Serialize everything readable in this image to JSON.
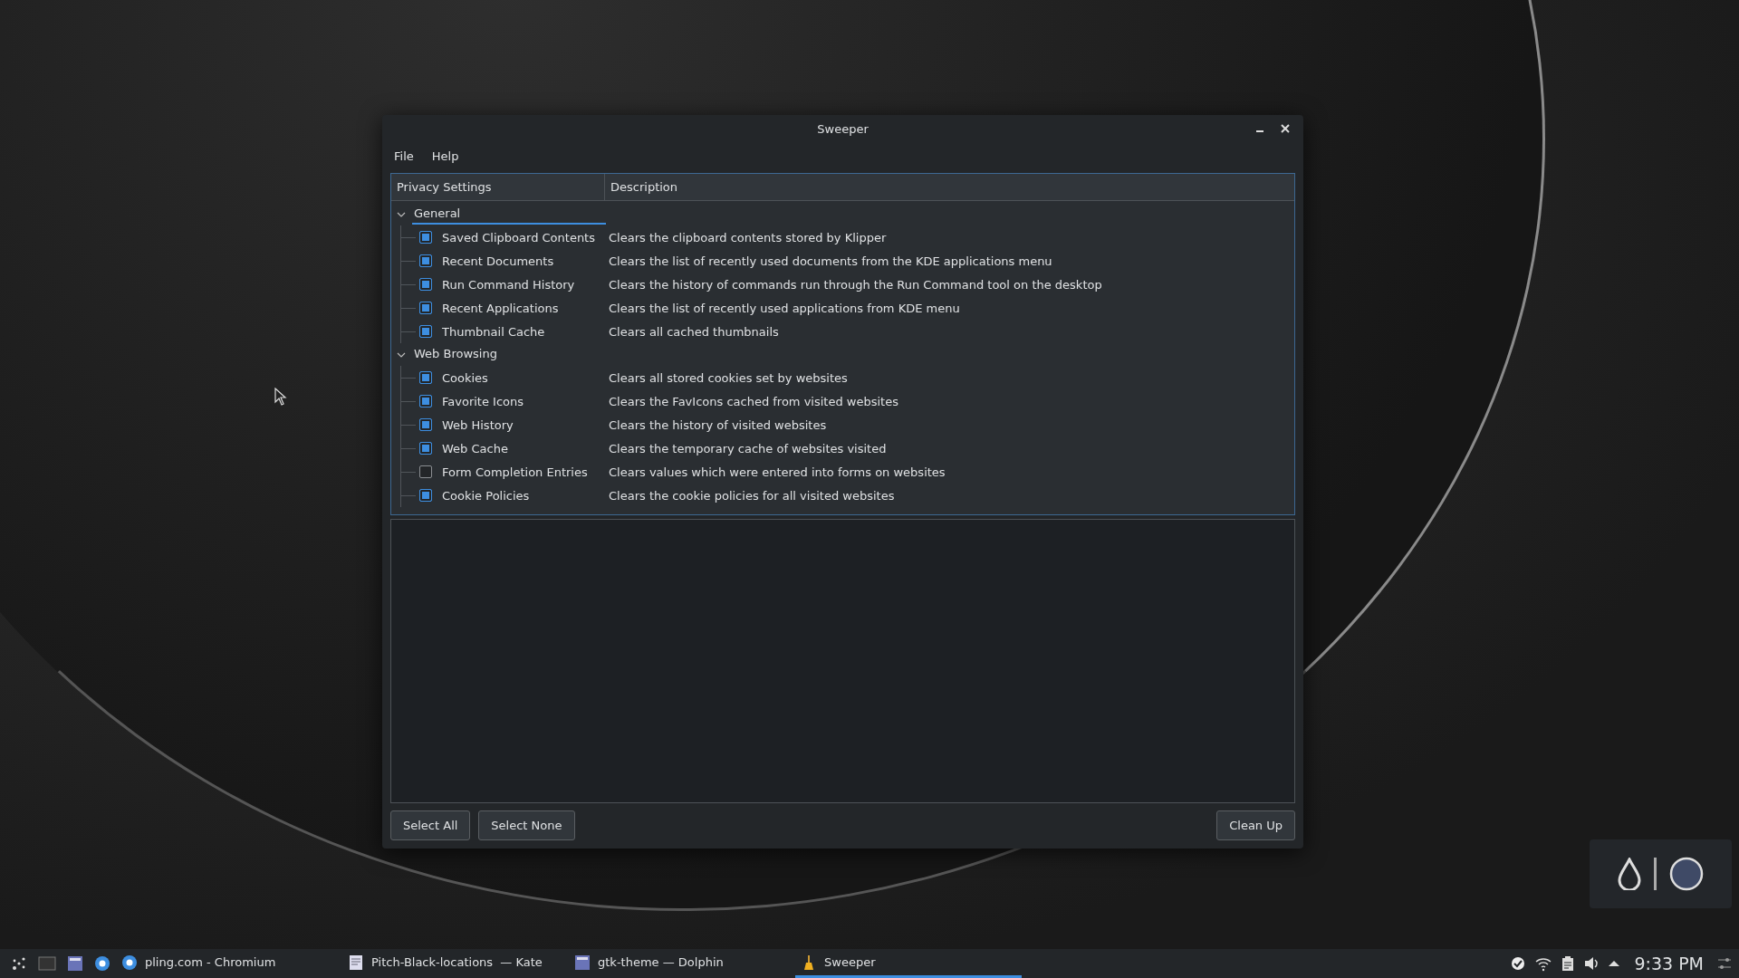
{
  "window": {
    "title": "Sweeper"
  },
  "menu": [
    "File",
    "Help"
  ],
  "tree": {
    "columns": [
      "Privacy Settings",
      "Description"
    ],
    "groups": [
      {
        "label": "General",
        "expanded": true,
        "selected": true,
        "children": [
          {
            "label": "Saved Clipboard Contents",
            "description": "Clears the clipboard contents stored by Klipper",
            "checked": true
          },
          {
            "label": "Recent Documents",
            "description": "Clears the list of recently used documents from the KDE applications menu",
            "checked": true
          },
          {
            "label": "Run Command History",
            "description": "Clears the history of commands run through the Run Command tool on the desktop",
            "checked": true
          },
          {
            "label": "Recent Applications",
            "description": "Clears the list of recently used applications from KDE menu",
            "checked": true
          },
          {
            "label": "Thumbnail Cache",
            "description": "Clears all cached thumbnails",
            "checked": true
          }
        ]
      },
      {
        "label": "Web Browsing",
        "expanded": true,
        "selected": false,
        "children": [
          {
            "label": "Cookies",
            "description": "Clears all stored cookies set by websites",
            "checked": true
          },
          {
            "label": "Favorite Icons",
            "description": "Clears the FavIcons cached from visited websites",
            "checked": true
          },
          {
            "label": "Web History",
            "description": "Clears the history of visited websites",
            "checked": true
          },
          {
            "label": "Web Cache",
            "description": "Clears the temporary cache of websites visited",
            "checked": true
          },
          {
            "label": "Form Completion Entries",
            "description": "Clears values which were entered into forms on websites",
            "checked": false
          },
          {
            "label": "Cookie Policies",
            "description": "Clears the cookie policies for all visited websites",
            "checked": true
          }
        ]
      }
    ]
  },
  "buttons": {
    "left": [
      "Select All",
      "Select None"
    ],
    "right": "Clean Up"
  },
  "taskbar": {
    "tasks": [
      {
        "label": "pling.com - Chromium",
        "kind": "browser",
        "selected": false
      },
      {
        "label": "Pitch-Black-locations  — Kate",
        "kind": "editor",
        "selected": false
      },
      {
        "label": "gtk-theme — Dolphin",
        "kind": "files",
        "selected": false
      },
      {
        "label": "Sweeper",
        "kind": "broom",
        "selected": true
      }
    ],
    "clock": "9:33 PM"
  }
}
